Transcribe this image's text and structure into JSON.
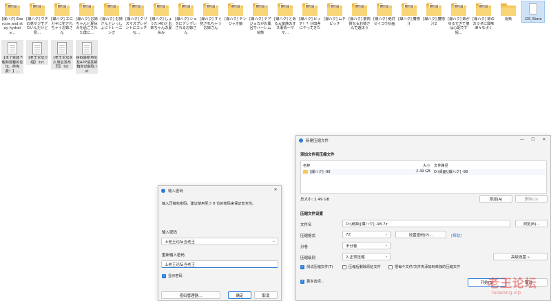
{
  "desktop": {
    "icons_row1": [
      {
        "label": "[爆ハク] Exercise and stay hydrate…",
        "kind": "folder"
      },
      {
        "label": "[爆ハク] ウチの弟マジでデカいんだけど見…",
        "kind": "folder"
      },
      {
        "label": "[爆ハク] エロガキに犯されちゃうお姉さん",
        "kind": "folder"
      },
      {
        "label": "[爆ハク] お姉ちゃんと夏休みを過ごされた僕に…",
        "kind": "folder"
      },
      {
        "label": "[爆ハク] お姉さんといっしょにトレーニング",
        "kind": "folder"
      },
      {
        "label": "[爆ハク] クリスマスプレゼントにエッチな…",
        "kind": "folder"
      },
      {
        "label": "[爆ハク] しょうた(40)とお姉ちゃんの夏休み",
        "kind": "folder"
      },
      {
        "label": "[爆ハク] ショタにデレデレされるお姉さん",
        "kind": "folder"
      },
      {
        "label": "[爆ハク] すぐ犯されちゃうお姉さん",
        "kind": "folder"
      },
      {
        "label": "[爆ハク] チンジャオ娘",
        "kind": "folder"
      },
      {
        "label": "[爆ハク] テアジョカがお風呂でハーレム状態",
        "kind": "folder"
      },
      {
        "label": "[爆ハク] とある大家族のオス事情～ママ…",
        "kind": "folder"
      },
      {
        "label": "[爆ハク] ビッチ！？が田舎にやってきた",
        "kind": "folder"
      },
      {
        "label": "[爆ハク] ムチビッチ",
        "kind": "folder"
      },
      {
        "label": "[爆ハク] 筋肉質な女お姉さんで遊ぼう",
        "kind": "folder"
      },
      {
        "label": "[爆ハク] 絶対セイコウ計画",
        "kind": "folder"
      },
      {
        "label": "[爆ハク] 魔物汁",
        "kind": "folder"
      },
      {
        "label": "[爆ハク] 魔物汁2",
        "kind": "folder"
      },
      {
        "label": "[爆ハク] 姉がゆるすぎて弟は心配です 姐…",
        "kind": "folder"
      },
      {
        "label": "[爆ハク] 姉のカラダに興味津々なボく",
        "kind": "folder"
      },
      {
        "label": "视频",
        "kind": "folder-plain"
      },
      {
        "label": ".DS_Store",
        "kind": "blank"
      }
    ],
    "icons_row2": [
      {
        "label": "【本了就能下载和观看的论坛，终免费！】…",
        "kind": "doc"
      },
      {
        "label": "【老王论坛介绍】.txt",
        "kind": "doc"
      },
      {
        "label": "【老王论坛永久地址发布页】.txt",
        "kind": "doc"
      },
      {
        "label": "获取最新地址及APP请发邮箱自动获取.txt",
        "kind": "doc"
      }
    ]
  },
  "password_dialog": {
    "title": "输入密码",
    "instruction": "输入压缩包密码。建议使用至少 8 位的密码来保证安全性。",
    "label_enter": "输入密码",
    "value_enter": "上老王论坛当老王",
    "label_reenter": "重新输入密码",
    "value_reenter": "上老王论坛当老王",
    "show_password_label": "显示密码",
    "btn_manager": "密码管理器...",
    "btn_ok": "确定",
    "btn_cancel": "取消"
  },
  "archive_dialog": {
    "title": "新建压缩文件",
    "section_add": "添加文件到压缩文件",
    "col_name": "名称",
    "col_size": "大小",
    "col_path": "文件路径",
    "row": {
      "name": "[爆ハク] -98",
      "size": "2.49 GB",
      "path": "D:\\桌面\\[爆ハク] -98"
    },
    "total": "总大小: 2.49 GB",
    "btn_add": "添加(A)",
    "btn_delete": "删除(D)",
    "section_settings": "压缩文件设置",
    "label_filename": "文件名",
    "value_filename": "D:\\桌面\\[爆ハク] -98.7z",
    "btn_browse": "浏览(B)...",
    "label_format": "压缩格式",
    "value_format": "7Z",
    "btn_set_password": "设置密码(P)...",
    "link_help": "[帮助]",
    "label_split": "分卷",
    "value_split": "不分卷",
    "label_level": "压缩级别",
    "value_level": "2-正常压缩",
    "btn_advanced": "高级设置 »",
    "check_test": "测试压缩文件(T)",
    "check_delete_source": "压缩后删除原始文件",
    "check_each_separate": "把每个文件/文件夹添加到单独的压缩文件",
    "check_more": "更多选项...",
    "btn_start": "开始(S)",
    "btn_cancel": "取消"
  },
  "watermark": {
    "main": "老王论坛",
    "sub": "laowang.vip"
  },
  "colors": {
    "accent": "#2a7bd6",
    "folder": "#f3c75a",
    "watermark": "#e04040",
    "selection": "#cfe3f8"
  }
}
